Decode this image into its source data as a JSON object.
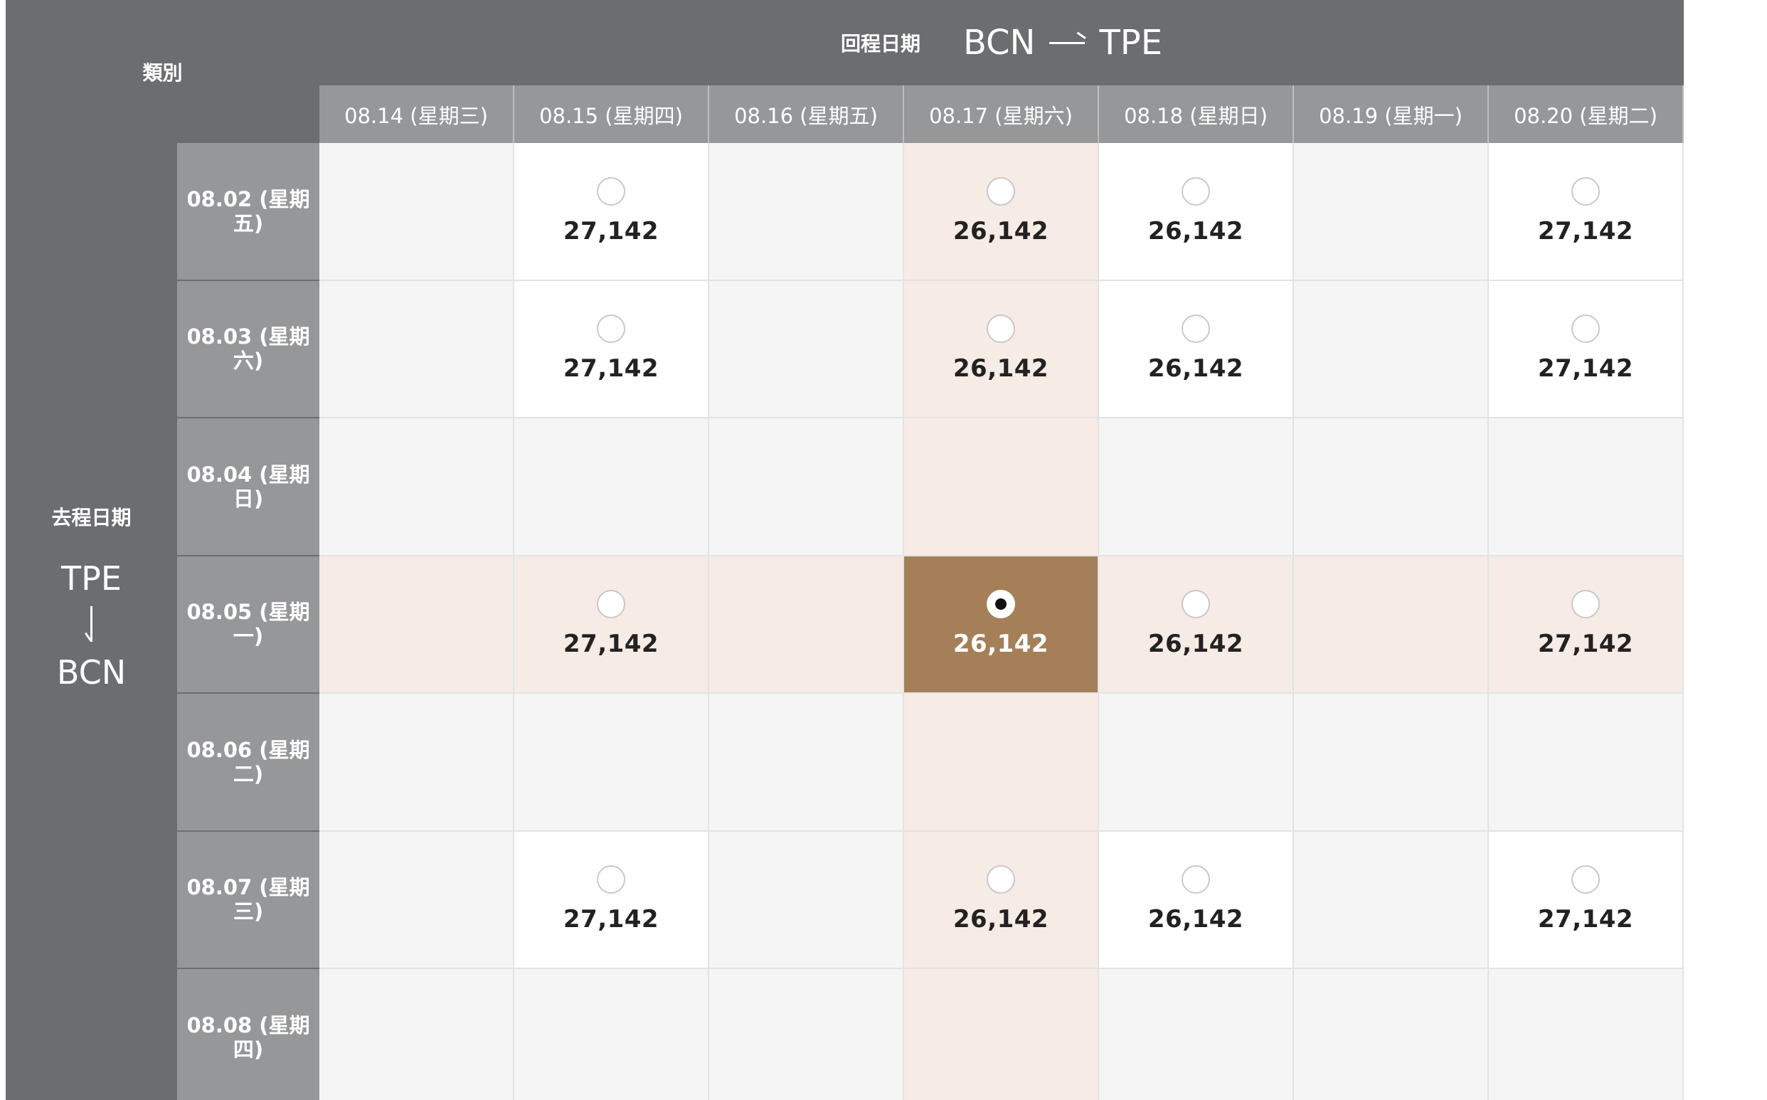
{
  "category_label": "類別",
  "return_header": {
    "label": "回程日期",
    "from": "BCN",
    "to": "TPE"
  },
  "depart_header": {
    "label": "去程日期",
    "from": "TPE",
    "to": "BCN"
  },
  "return_dates": [
    "08.14 (星期三)",
    "08.15 (星期四)",
    "08.16 (星期五)",
    "08.17 (星期六)",
    "08.18 (星期日)",
    "08.19 (星期一)",
    "08.20 (星期二)"
  ],
  "depart_dates": [
    "08.02 (星期五)",
    "08.03 (星期六)",
    "08.04 (星期日)",
    "08.05 (星期一)",
    "08.06 (星期二)",
    "08.07 (星期三)",
    "08.08 (星期四)"
  ],
  "prices": [
    [
      null,
      "27,142",
      null,
      "26,142",
      "26,142",
      null,
      "27,142"
    ],
    [
      null,
      "27,142",
      null,
      "26,142",
      "26,142",
      null,
      "27,142"
    ],
    [
      null,
      null,
      null,
      null,
      null,
      null,
      null
    ],
    [
      null,
      "27,142",
      null,
      "26,142",
      "26,142",
      null,
      "27,142"
    ],
    [
      null,
      null,
      null,
      null,
      null,
      null,
      null
    ],
    [
      null,
      "27,142",
      null,
      "26,142",
      "26,142",
      null,
      "27,142"
    ],
    [
      null,
      null,
      null,
      null,
      null,
      null,
      null
    ]
  ],
  "selected": {
    "row": 3,
    "col": 3
  },
  "colors": {
    "header_dark": "#6c6d6f",
    "header_light": "#969799",
    "highlight": "#f6ebe5",
    "selected": "#a57f58",
    "empty": "#f5f5f5"
  }
}
